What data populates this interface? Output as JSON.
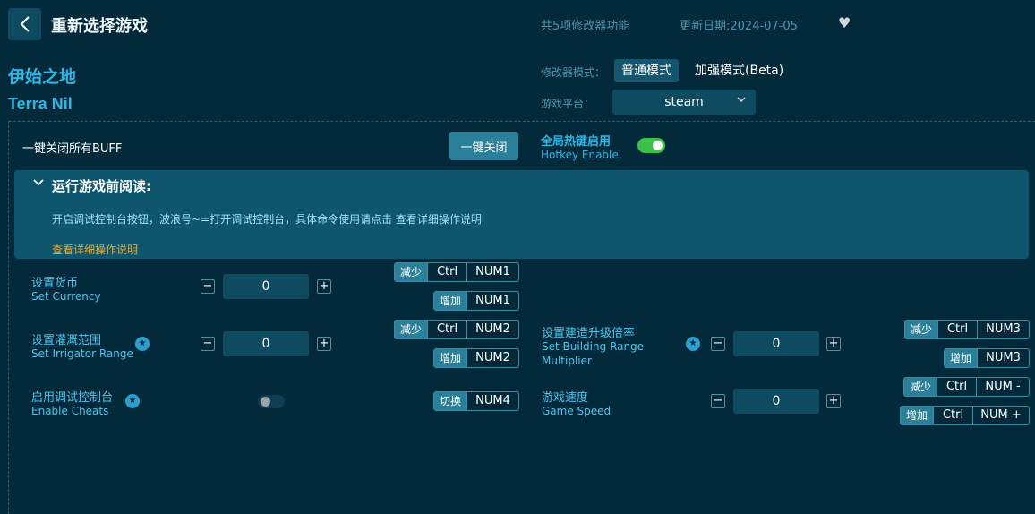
{
  "header": {
    "title": "重新选择游戏",
    "feature_count": "共5项修改器功能",
    "update_date": "更新日期:2024-07-05"
  },
  "game": {
    "name_cn": "伊始之地",
    "name_en": "Terra Nil"
  },
  "mode": {
    "label": "修改器模式：",
    "normal": "普通模式",
    "enhanced": "加强模式(Beta)"
  },
  "platform": {
    "label": "游戏平台：",
    "value": "steam"
  },
  "buff": {
    "label": "一键关闭所有BUFF",
    "button": "一键关闭"
  },
  "hotkey": {
    "label_cn": "全局热键启用",
    "label_en": "Hotkey Enable",
    "enabled": true
  },
  "notice": {
    "title": "运行游戏前阅读:",
    "body": "开启调试控制台按钮，波浪号~=打开调试控制台，具体命令使用请点击 查看详细操作说明",
    "link": "查看详细操作说明"
  },
  "cheats": {
    "currency": {
      "name_cn": "设置货币",
      "name_en": "Set Currency",
      "value": "0",
      "dec": {
        "tag": "减少",
        "mod": "Ctrl",
        "key": "NUM1"
      },
      "inc": {
        "tag": "增加",
        "key": "NUM1"
      }
    },
    "irrigator": {
      "name_cn": "设置灌溉范围",
      "name_en": "Set Irrigator Range",
      "value": "0",
      "dec": {
        "tag": "减少",
        "mod": "Ctrl",
        "key": "NUM2"
      },
      "inc": {
        "tag": "增加",
        "key": "NUM2"
      }
    },
    "cheats_enable": {
      "name_cn": "启用调试控制台",
      "name_en": "Enable Cheats",
      "enabled": false,
      "toggle": {
        "tag": "切换",
        "key": "NUM4"
      }
    },
    "building": {
      "name_cn": "设置建造升级倍率",
      "name_en_1": "Set Building Range",
      "name_en_2": "Multiplier",
      "value": "0",
      "dec": {
        "tag": "减少",
        "mod": "Ctrl",
        "key": "NUM3"
      },
      "inc": {
        "tag": "增加",
        "key": "NUM3"
      }
    },
    "speed": {
      "name_cn": "游戏速度",
      "name_en": "Game Speed",
      "value": "0",
      "dec": {
        "tag": "减少",
        "mod": "Ctrl",
        "key": "NUM -"
      },
      "inc": {
        "tag": "增加",
        "mod": "Ctrl",
        "key": "NUM +"
      }
    }
  },
  "colors": {
    "background": "#032a3a",
    "accent": "#2cb7e6",
    "panel": "#0e566e",
    "toggle_on": "#3bc24a",
    "link": "#f0a92a"
  }
}
